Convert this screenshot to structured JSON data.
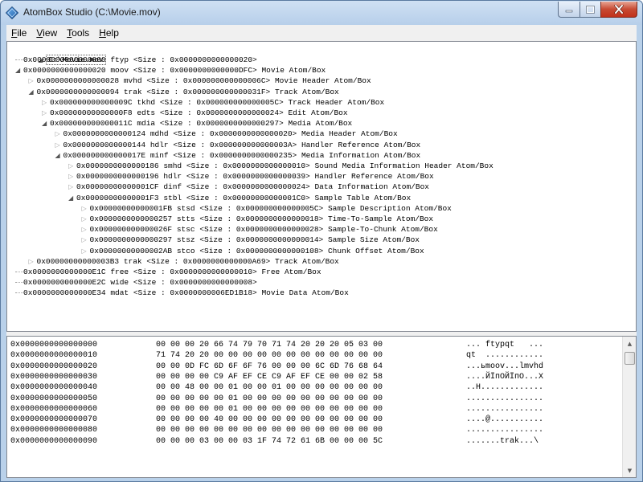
{
  "window": {
    "title": "AtomBox Studio (C:\\Movie.mov)",
    "accent": "#1f5fa8"
  },
  "menu": [
    {
      "label_pre": "",
      "label_u": "F",
      "label_post": "ile"
    },
    {
      "label_pre": "",
      "label_u": "V",
      "label_post": "iew"
    },
    {
      "label_pre": "",
      "label_u": "T",
      "label_post": "ools"
    },
    {
      "label_pre": "",
      "label_u": "H",
      "label_post": "elp"
    }
  ],
  "tree": {
    "root": "C:\\Movie.mov",
    "nodes": [
      {
        "level": 1,
        "expander": "none",
        "text": "0x0000000000000000 ftyp <Size : 0x0000000000000020>"
      },
      {
        "level": 1,
        "expander": "expanded",
        "text": "0x0000000000000020 moov <Size : 0x0000000000000DFC> Movie Atom/Box"
      },
      {
        "level": 2,
        "expander": "collapsed",
        "text": "0x0000000000000028 mvhd <Size : 0x000000000000006C> Movie Header Atom/Box"
      },
      {
        "level": 2,
        "expander": "expanded",
        "text": "0x0000000000000094 trak <Size : 0x000000000000031F> Track Atom/Box"
      },
      {
        "level": 3,
        "expander": "collapsed",
        "text": "0x000000000000009C tkhd <Size : 0x000000000000005C> Track Header Atom/Box"
      },
      {
        "level": 3,
        "expander": "collapsed",
        "text": "0x00000000000000F8 edts <Size : 0x0000000000000024> Edit Atom/Box"
      },
      {
        "level": 3,
        "expander": "expanded",
        "text": "0x000000000000011C mdia <Size : 0x0000000000000297> Media Atom/Box"
      },
      {
        "level": 4,
        "expander": "collapsed",
        "text": "0x0000000000000124 mdhd <Size : 0x0000000000000020> Media Header Atom/Box"
      },
      {
        "level": 4,
        "expander": "collapsed",
        "text": "0x0000000000000144 hdlr <Size : 0x000000000000003A> Handler Reference Atom/Box"
      },
      {
        "level": 4,
        "expander": "expanded",
        "text": "0x000000000000017E minf <Size : 0x0000000000000235> Media Information Atom/Box"
      },
      {
        "level": 5,
        "expander": "collapsed",
        "text": "0x0000000000000186 smhd <Size : 0x0000000000000010> Sound Media Information Header Atom/Box"
      },
      {
        "level": 5,
        "expander": "collapsed",
        "text": "0x0000000000000196 hdlr <Size : 0x0000000000000039> Handler Reference Atom/Box"
      },
      {
        "level": 5,
        "expander": "collapsed",
        "text": "0x00000000000001CF dinf <Size : 0x0000000000000024> Data Information Atom/Box"
      },
      {
        "level": 5,
        "expander": "expanded",
        "text": "0x00000000000001F3 stbl <Size : 0x00000000000001C0> Sample Table Atom/Box"
      },
      {
        "level": 6,
        "expander": "collapsed",
        "text": "0x00000000000001FB stsd <Size : 0x000000000000005C> Sample Description Atom/Box"
      },
      {
        "level": 6,
        "expander": "collapsed",
        "text": "0x0000000000000257 stts <Size : 0x0000000000000018> Time-To-Sample Atom/Box"
      },
      {
        "level": 6,
        "expander": "collapsed",
        "text": "0x000000000000026F stsc <Size : 0x0000000000000028> Sample-To-Chunk Atom/Box"
      },
      {
        "level": 6,
        "expander": "collapsed",
        "text": "0x0000000000000297 stsz <Size : 0x0000000000000014> Sample Size Atom/Box"
      },
      {
        "level": 6,
        "expander": "collapsed",
        "text": "0x00000000000002AB stco <Size : 0x0000000000000108> Chunk Offset Atom/Box"
      },
      {
        "level": 2,
        "expander": "collapsed",
        "text": "0x00000000000003B3 trak <Size : 0x0000000000000A69> Track Atom/Box"
      },
      {
        "level": 1,
        "expander": "none",
        "text": "0x0000000000000E1C free <Size : 0x0000000000000010> Free Atom/Box"
      },
      {
        "level": 1,
        "expander": "none",
        "text": "0x0000000000000E2C wide <Size : 0x0000000000000008>"
      },
      {
        "level": 1,
        "expander": "none",
        "text": "0x0000000000000E34 mdat <Size : 0x0000000006ED1B18> Movie Data Atom/Box"
      }
    ]
  },
  "hex": {
    "rows": [
      {
        "addr": "0x0000000000000000",
        "bytes": "00 00 00 20 66 74 79 70 71 74 20 20 20 05 03 00",
        "ascii": "... ftypqt   ..."
      },
      {
        "addr": "0x0000000000000010",
        "bytes": "71 74 20 20 00 00 00 00 00 00 00 00 00 00 00 00",
        "ascii": "qt  ............"
      },
      {
        "addr": "0x0000000000000020",
        "bytes": "00 00 0D FC 6D 6F 6F 76 00 00 00 6C 6D 76 68 64",
        "ascii": "...ьmoov...lmvhd"
      },
      {
        "addr": "0x0000000000000030",
        "bytes": "00 00 00 00 C9 AF EF CE C9 AF EF CE 00 00 02 58",
        "ascii": "....ЙЇпОЙЇпО...X"
      },
      {
        "addr": "0x0000000000000040",
        "bytes": "00 00 48 00 00 01 00 00 01 00 00 00 00 00 00 00",
        "ascii": "..H............."
      },
      {
        "addr": "0x0000000000000050",
        "bytes": "00 00 00 00 00 01 00 00 00 00 00 00 00 00 00 00",
        "ascii": "................"
      },
      {
        "addr": "0x0000000000000060",
        "bytes": "00 00 00 00 00 01 00 00 00 00 00 00 00 00 00 00",
        "ascii": "................"
      },
      {
        "addr": "0x0000000000000070",
        "bytes": "00 00 00 00 40 00 00 00 00 00 00 00 00 00 00 00",
        "ascii": "....@..........."
      },
      {
        "addr": "0x0000000000000080",
        "bytes": "00 00 00 00 00 00 00 00 00 00 00 00 00 00 00 00",
        "ascii": "................"
      },
      {
        "addr": "0x0000000000000090",
        "bytes": "00 00 00 03 00 00 03 1F 74 72 61 6B 00 00 00 5C",
        "ascii": ".......trak...\\"
      }
    ]
  },
  "icons": {
    "app": "app-diamond-icon",
    "minimize": "minimize-icon",
    "maximize": "maximize-icon",
    "close": "close-icon",
    "expanded": "triangle-down-icon",
    "collapsed": "triangle-right-icon",
    "scroll_up": "scroll-up-icon",
    "scroll_down": "scroll-down-icon"
  }
}
